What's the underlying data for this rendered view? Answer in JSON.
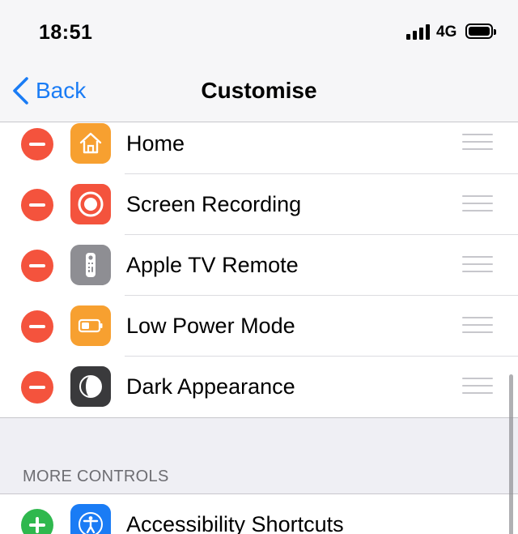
{
  "status_bar": {
    "time": "18:51",
    "network": "4G",
    "icons": [
      "signal-bars-icon",
      "battery-icon"
    ]
  },
  "nav": {
    "back_label": "Back",
    "title": "Customise"
  },
  "included_controls": [
    {
      "label": "Home",
      "icon": "home-icon",
      "color": "#f7a030"
    },
    {
      "label": "Screen Recording",
      "icon": "screen-recording-icon",
      "color": "#f4533d"
    },
    {
      "label": "Apple TV Remote",
      "icon": "tv-remote-icon",
      "color": "#8e8e93"
    },
    {
      "label": "Low Power Mode",
      "icon": "battery-icon",
      "color": "#f7a030"
    },
    {
      "label": "Dark Appearance",
      "icon": "dark-mode-icon",
      "color": "#3a3a3c"
    }
  ],
  "more_controls": {
    "header": "MORE CONTROLS",
    "items": [
      {
        "label": "Accessibility Shortcuts",
        "icon": "accessibility-icon",
        "color": "#1a7cf5"
      }
    ]
  },
  "colors": {
    "accent": "#1a7cf5",
    "remove": "#f4533d",
    "add": "#2fb84e"
  }
}
